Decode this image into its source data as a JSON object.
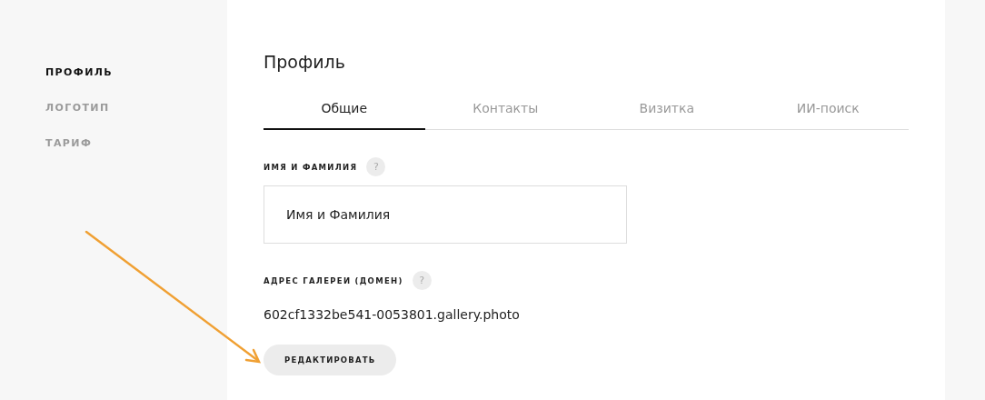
{
  "sidebar": {
    "items": [
      {
        "label": "ПРОФИЛЬ",
        "selected": true
      },
      {
        "label": "ЛОГОТИП",
        "selected": false
      },
      {
        "label": "ТАРИФ",
        "selected": false
      }
    ]
  },
  "page": {
    "title": "Профиль"
  },
  "tabs": [
    {
      "label": "Общие",
      "selected": true
    },
    {
      "label": "Контакты",
      "selected": false
    },
    {
      "label": "Визитка",
      "selected": false
    },
    {
      "label": "ИИ-поиск",
      "selected": false
    }
  ],
  "fields": [
    {
      "kind": "input",
      "label": "ИМЯ И ФАМИЛИЯ",
      "help": "?",
      "value": "Имя и Фамилия"
    },
    {
      "kind": "static",
      "label": "АДРЕС ГАЛЕРЕИ (ДОМЕН)",
      "help": "?",
      "value": "602cf1332be541-0053801.gallery.photo"
    }
  ],
  "button": {
    "label": "РЕДАКТИРОВАТЬ"
  }
}
